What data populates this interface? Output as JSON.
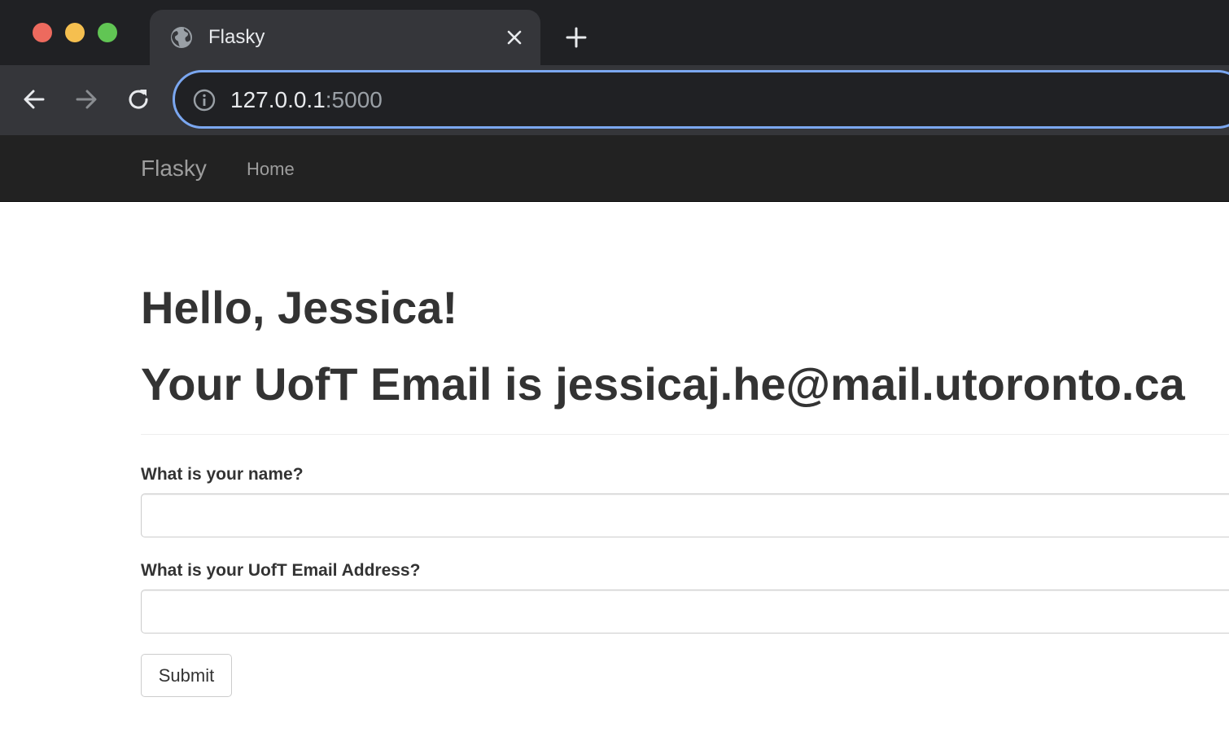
{
  "browser": {
    "tab": {
      "title": "Flasky",
      "favicon_icon": "globe-icon",
      "close_icon": "close-icon"
    },
    "new_tab_icon": "plus-icon",
    "nav": {
      "back_icon": "arrow-left-icon",
      "forward_icon": "arrow-right-icon",
      "reload_icon": "reload-icon"
    },
    "address_bar": {
      "info_icon": "info-icon",
      "url_host": "127.0.0.1",
      "url_port": ":5000"
    },
    "colors": {
      "omnibox_focus": "#7ba7f0",
      "close_red": "#ed6a5e",
      "minimize_yellow": "#f5bf4f",
      "maximize_green": "#61c554"
    }
  },
  "navbar": {
    "brand": "Flasky",
    "links": [
      {
        "label": "Home"
      }
    ]
  },
  "page": {
    "greeting": "Hello, Jessica!",
    "email_message": "Your UofT Email is jessicaj.he@mail.utoronto.ca",
    "form": {
      "name_label": "What is your name?",
      "name_value": "",
      "email_label": "What is your UofT Email Address?",
      "email_value": "",
      "submit_label": "Submit"
    }
  }
}
